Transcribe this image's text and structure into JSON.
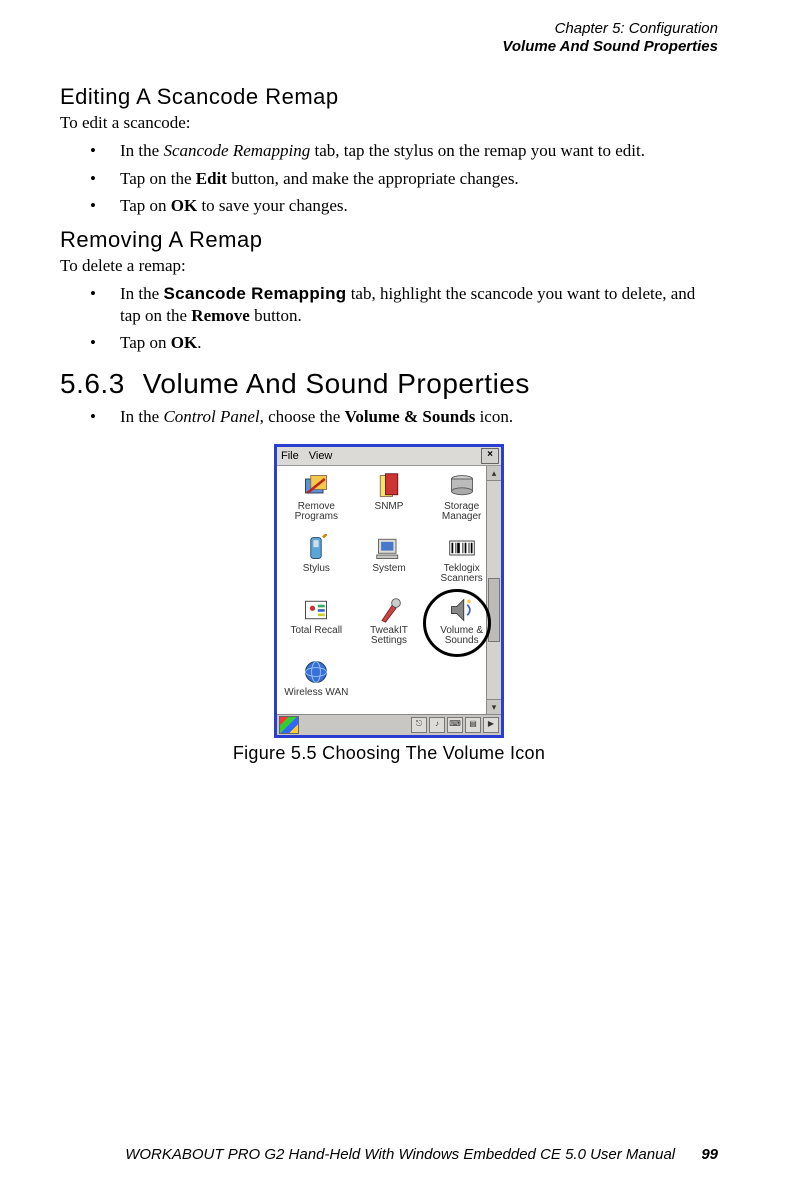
{
  "header": {
    "chapter": "Chapter 5: Configuration",
    "section": "Volume And Sound Properties"
  },
  "sub1": {
    "title": "Editing A Scancode Remap",
    "intro": "To edit a scancode:",
    "items": [
      {
        "pre": "In the ",
        "em": "Scancode Remapping",
        "post": " tab, tap the stylus on the remap you want to edit."
      },
      {
        "pre": "Tap on the ",
        "bold": "Edit",
        "post": " button, and make the appropriate changes."
      },
      {
        "pre": "Tap on ",
        "bold": "OK",
        "post": " to save your changes."
      }
    ]
  },
  "sub2": {
    "title": "Removing A Remap",
    "intro": "To delete a remap:",
    "items": [
      {
        "pre": "In the ",
        "cond": "Scancode Remapping",
        "mid": " tab, highlight the scancode you want to delete, and tap on the ",
        "bold": "Remove",
        "post": " button."
      },
      {
        "pre": "Tap on ",
        "bold": "OK",
        "post": "."
      }
    ]
  },
  "section563": {
    "num": "5.6.3",
    "title": "Volume And Sound Properties",
    "item": {
      "pre": "In the ",
      "em": "Control Panel",
      "mid": ", choose the ",
      "bold": "Volume & Sounds",
      "post": " icon."
    }
  },
  "figure": {
    "menubar": {
      "file": "File",
      "view": "View"
    },
    "icons": [
      "Remove Programs",
      "SNMP",
      "Storage Manager",
      "Stylus",
      "System",
      "Teklogix Scanners",
      "Total Recall",
      "TweakIT Settings",
      "Volume & Sounds",
      "Wireless WAN",
      "",
      ""
    ],
    "caption": "Figure 5.5 Choosing The Volume Icon"
  },
  "footer": {
    "text": "WORKABOUT PRO G2 Hand-Held With Windows Embedded CE 5.0 User Manual",
    "page": "99"
  }
}
